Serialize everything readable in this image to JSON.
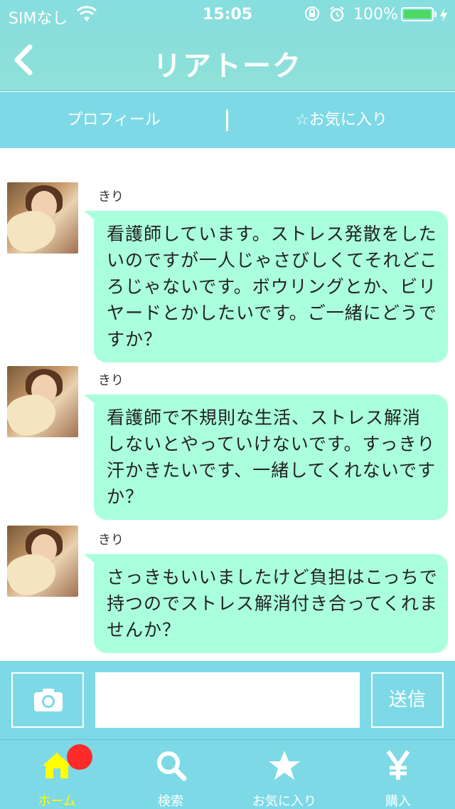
{
  "status_bar": {
    "carrier": "SIMなし",
    "time": "15:05",
    "battery_percent": "100%",
    "battery_level": 1.0,
    "battery_color": "#4cd964"
  },
  "header": {
    "title": "リアトーク",
    "back_icon": "chevron-left-icon"
  },
  "subtabs": {
    "profile": "プロフィール",
    "favorite": "☆お気に入り"
  },
  "messages": [
    {
      "sender": "きり",
      "text": "看護師しています。ストレス発散をしたいのですが一人じゃさびしくてそれどころじゃないです。ボウリングとか、ビリヤードとかしたいです。ご一緒にどうですか？"
    },
    {
      "sender": "きり",
      "text": "看護師で不規則な生活、ストレス解消しないとやっていけないです。すっきり汗かきたいです、一緒してくれないですか？"
    },
    {
      "sender": "きり",
      "text": "さっきもいいましたけど負担はこっちで持つのでストレス解消付き合ってくれませんか？"
    }
  ],
  "input": {
    "value": "",
    "send_label": "送信",
    "camera_icon": "camera-icon"
  },
  "tabbar": {
    "items": [
      {
        "label": "ホーム",
        "icon": "home-icon",
        "active": true
      },
      {
        "label": "検索",
        "icon": "search-icon",
        "active": false
      },
      {
        "label": "お気に入り",
        "icon": "star-icon",
        "active": false
      },
      {
        "label": "購入",
        "icon": "yen-icon",
        "active": false
      }
    ],
    "active_color": "#ffff00",
    "badge_color": "#ff2a2a"
  },
  "colors": {
    "header": "#86dede",
    "bar": "#7dd9e6",
    "bubble": "#aaffdd"
  }
}
